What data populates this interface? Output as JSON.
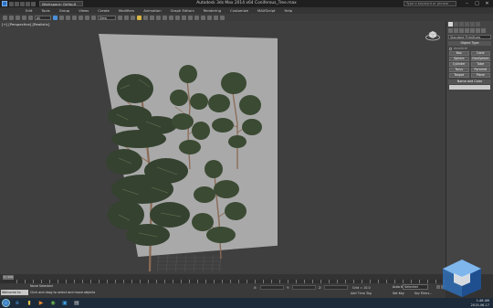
{
  "titlebar": {
    "workspace": "Workspace: Default",
    "title": "Autodesk 3ds Max  2014 x64      Coniferous_Tree.max",
    "search_placeholder": "Type a keyword or phrase",
    "min": "–",
    "max": "□",
    "close": "✕"
  },
  "menubar": {
    "items": [
      "Edit",
      "Tools",
      "Group",
      "Views",
      "Create",
      "Modifiers",
      "Animation",
      "Graph Editors",
      "Rendering",
      "Customize",
      "MAXScript",
      "Help"
    ]
  },
  "toolbar": {
    "selection_filter": "All",
    "ref_coord": "View"
  },
  "viewport": {
    "label": "[+] [Perspective] [Realistic]"
  },
  "command_panel": {
    "category": "Standard Primitives",
    "rollout_object_type": "Object Type",
    "autogrid": "AutoGrid",
    "buttons": [
      "Box",
      "Cone",
      "Sphere",
      "GeoSphere",
      "Cylinder",
      "Tube",
      "Torus",
      "Pyramid",
      "Teapot",
      "Plane"
    ],
    "rollout_name_color": "Name and Color"
  },
  "timeline": {
    "slider": "0 / 100"
  },
  "status": {
    "maxscript": "Welcome to MAX",
    "line1": "None Selected",
    "line2": "Click and drag to select and move objects",
    "x_label": "X:",
    "y_label": "Y:",
    "z_label": "Z:",
    "grid": "Grid = 10.0",
    "auto_key": "Auto Key",
    "selected": "Selected",
    "set_key": "Set Key",
    "key_filters": "Key Filters...",
    "add_time_tag": "Add Time Tag"
  },
  "taskbar": {
    "time": "1:48 AM",
    "date": "2015-06-17"
  },
  "colors": {
    "viewport_bg": "#3f3f3f",
    "plane": "#a9a9a9",
    "foliage": "#3b4a33",
    "trunk": "#8a6a55",
    "accent": "#4a8fd8"
  }
}
